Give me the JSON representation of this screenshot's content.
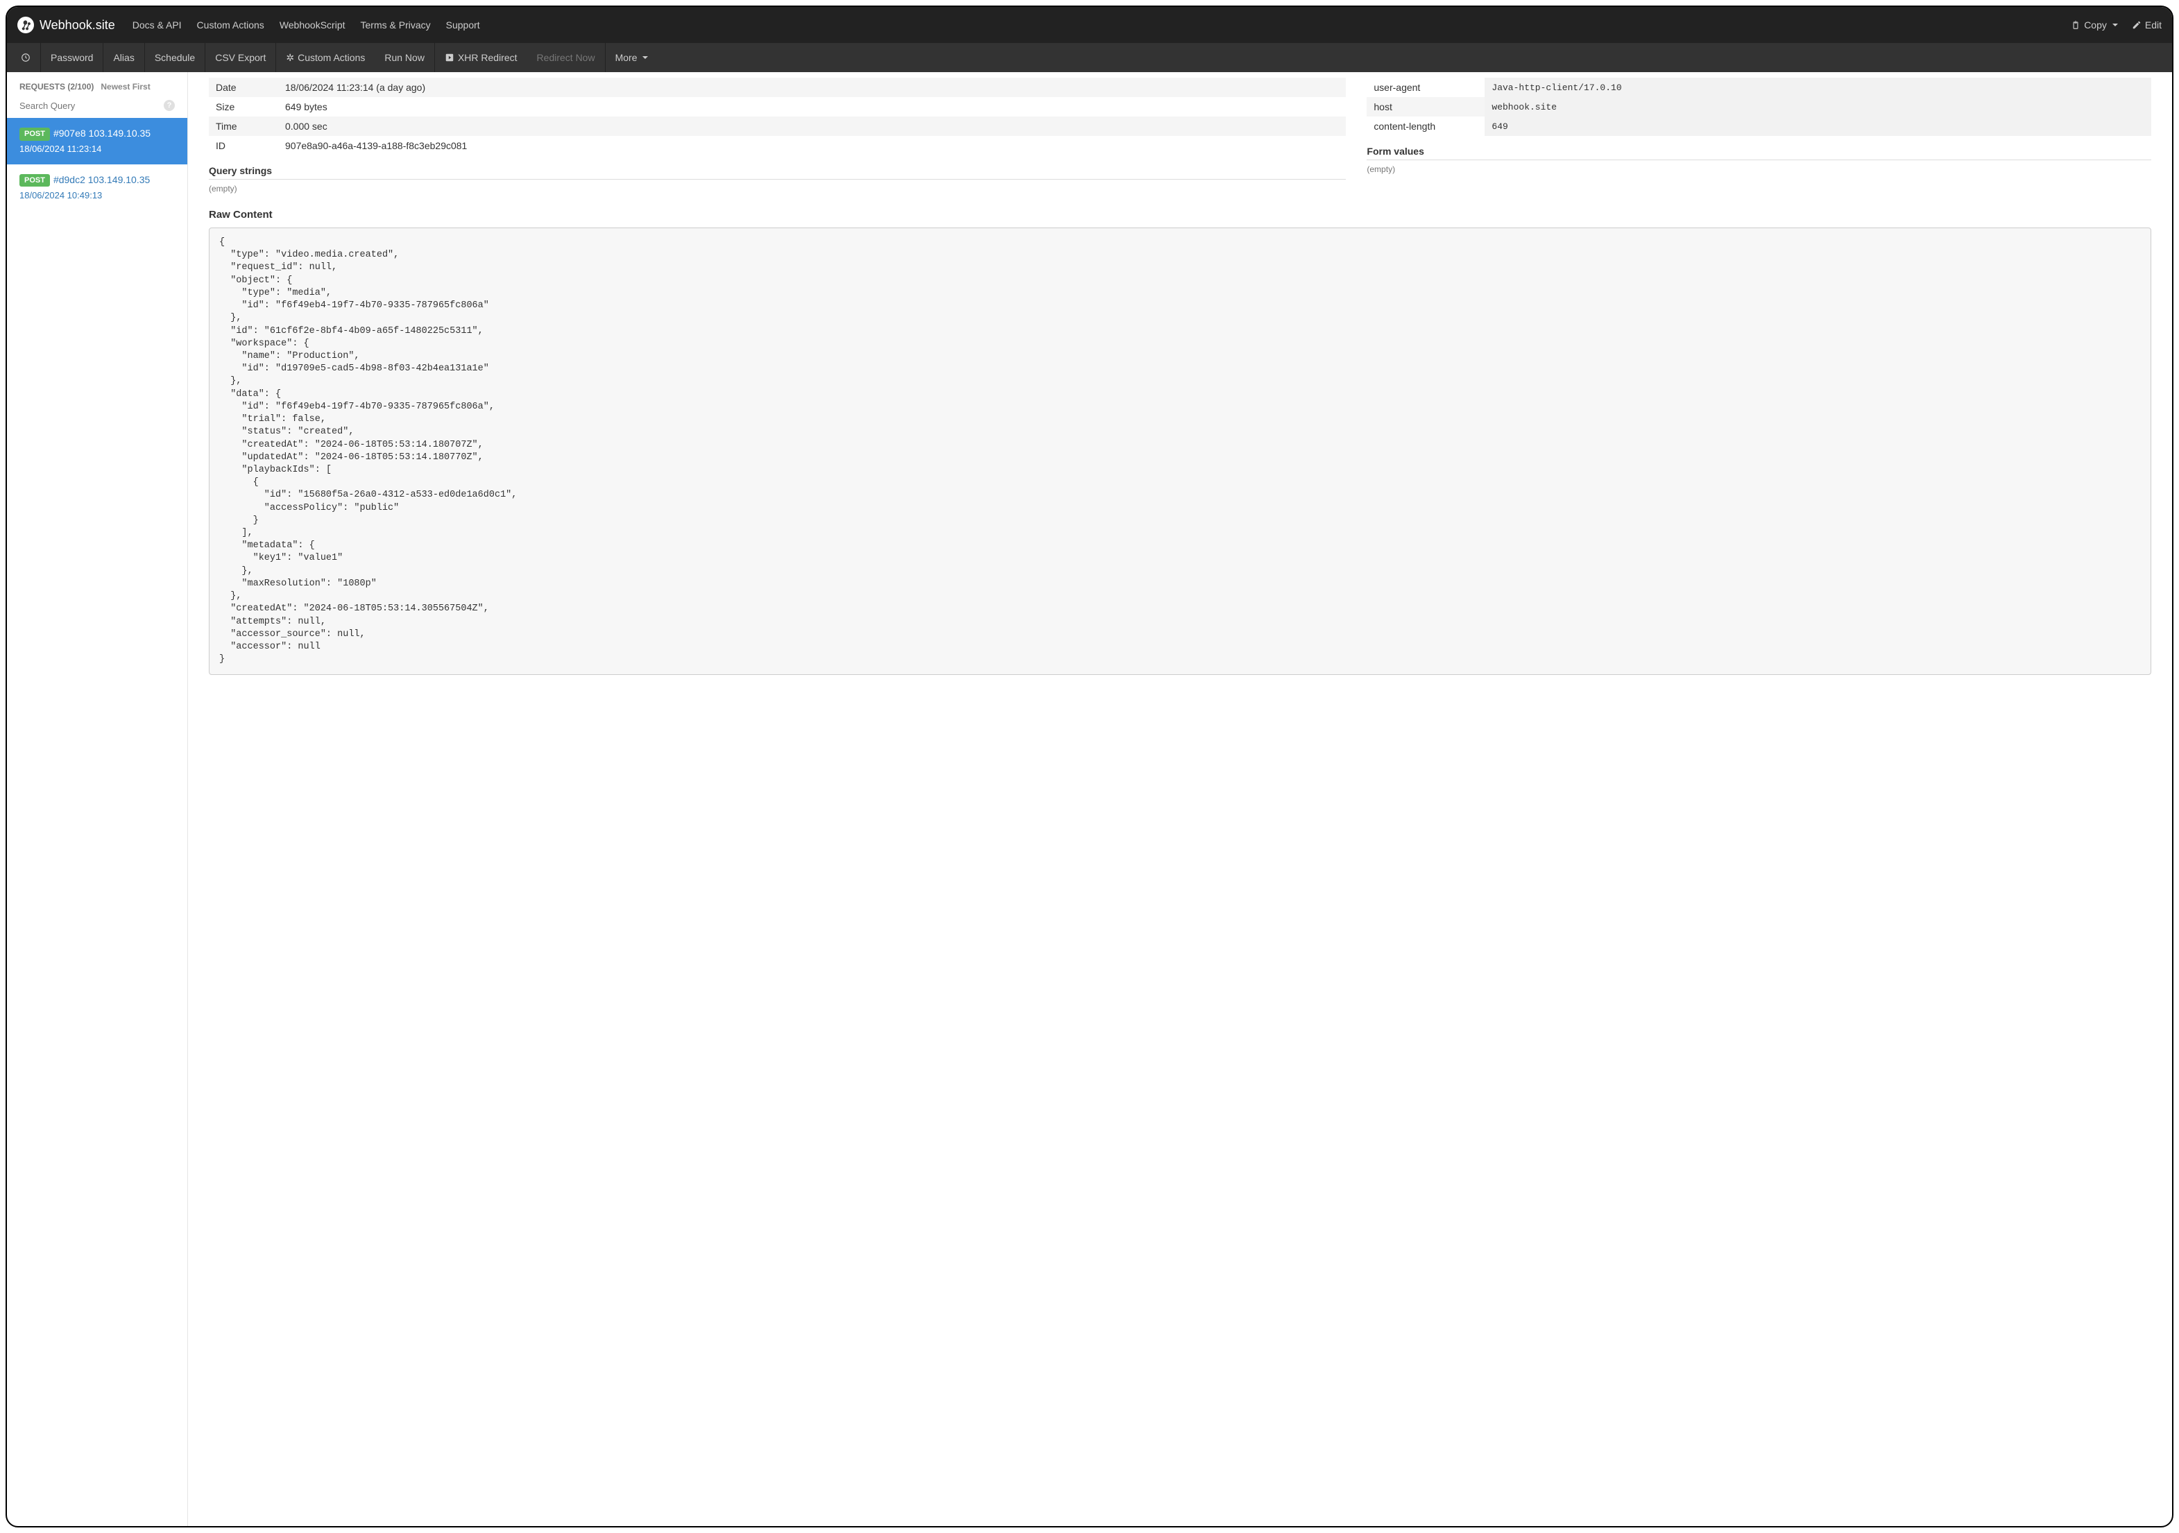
{
  "brand": {
    "name": "Webhook.site"
  },
  "topnav": {
    "links": [
      "Docs & API",
      "Custom Actions",
      "WebhookScript",
      "Terms & Privacy",
      "Support"
    ],
    "copy": "Copy",
    "edit": "Edit"
  },
  "subnav": {
    "password": "Password",
    "alias": "Alias",
    "schedule": "Schedule",
    "csv": "CSV Export",
    "custom_actions": "Custom Actions",
    "run_now": "Run Now",
    "xhr": "XHR Redirect",
    "redirect_now": "Redirect Now",
    "more": "More"
  },
  "sidebar": {
    "requests_label": "REQUESTS (2/100)",
    "sort": "Newest First",
    "search_placeholder": "Search Query",
    "items": [
      {
        "method": "POST",
        "title": "#907e8 103.149.10.35",
        "ts": "18/06/2024 11:23:14",
        "active": true
      },
      {
        "method": "POST",
        "title": "#d9dc2 103.149.10.35",
        "ts": "18/06/2024 10:49:13",
        "active": false
      }
    ]
  },
  "details": {
    "rows": [
      {
        "k": "Date",
        "v": "18/06/2024 11:23:14 (a day ago)"
      },
      {
        "k": "Size",
        "v": "649 bytes"
      },
      {
        "k": "Time",
        "v": "0.000 sec"
      },
      {
        "k": "ID",
        "v": "907e8a90-a46a-4139-a188-f8c3eb29c081"
      }
    ],
    "headers": [
      {
        "k": "user-agent",
        "v": "Java-http-client/17.0.10"
      },
      {
        "k": "host",
        "v": "webhook.site"
      },
      {
        "k": "content-length",
        "v": "649"
      }
    ],
    "qs_title": "Query strings",
    "qs_empty": "(empty)",
    "form_title": "Form values",
    "form_empty": "(empty)",
    "raw_title": "Raw Content",
    "raw": "{\n  \"type\": \"video.media.created\",\n  \"request_id\": null,\n  \"object\": {\n    \"type\": \"media\",\n    \"id\": \"f6f49eb4-19f7-4b70-9335-787965fc806a\"\n  },\n  \"id\": \"61cf6f2e-8bf4-4b09-a65f-1480225c5311\",\n  \"workspace\": {\n    \"name\": \"Production\",\n    \"id\": \"d19709e5-cad5-4b98-8f03-42b4ea131a1e\"\n  },\n  \"data\": {\n    \"id\": \"f6f49eb4-19f7-4b70-9335-787965fc806a\",\n    \"trial\": false,\n    \"status\": \"created\",\n    \"createdAt\": \"2024-06-18T05:53:14.180707Z\",\n    \"updatedAt\": \"2024-06-18T05:53:14.180770Z\",\n    \"playbackIds\": [\n      {\n        \"id\": \"15680f5a-26a0-4312-a533-ed0de1a6d0c1\",\n        \"accessPolicy\": \"public\"\n      }\n    ],\n    \"metadata\": {\n      \"key1\": \"value1\"\n    },\n    \"maxResolution\": \"1080p\"\n  },\n  \"createdAt\": \"2024-06-18T05:53:14.305567504Z\",\n  \"attempts\": null,\n  \"accessor_source\": null,\n  \"accessor\": null\n}"
  }
}
